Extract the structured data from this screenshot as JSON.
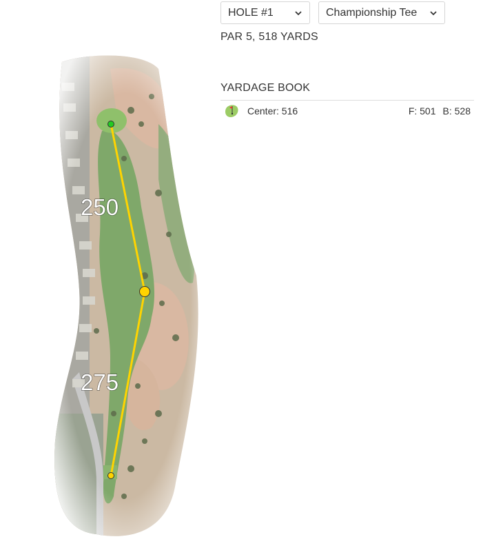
{
  "hole_select": {
    "value": "HOLE #1"
  },
  "tee_select": {
    "value": "Championship Tee"
  },
  "hole_info": "PAR 5, 518 YARDS",
  "yardage_book": {
    "title": "YARDAGE BOOK",
    "rows": [
      {
        "icon": "green-flag-icon",
        "center": "Center: 516",
        "front": "F: 501",
        "back": "B: 528"
      }
    ]
  },
  "map": {
    "distance_labels": [
      "250",
      "275"
    ],
    "colors": {
      "shot_line": "#ffd400",
      "pin_marker": "#22cc22",
      "fairway": "#7fa86a",
      "rough": "#a3b98d",
      "sand": "#d9b8a2"
    }
  }
}
